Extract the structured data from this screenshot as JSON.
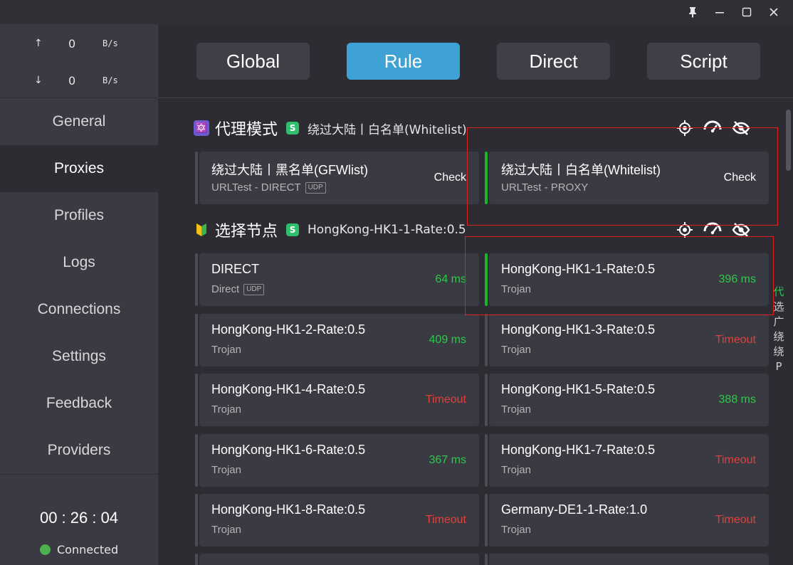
{
  "window": {
    "controls": [
      "pin-icon",
      "minimize-icon",
      "maximize-icon",
      "close-icon"
    ]
  },
  "speed": {
    "up_arrow": "↑",
    "up_value": "0",
    "up_unit": "B/s",
    "down_arrow": "↓",
    "down_value": "0",
    "down_unit": "B/s"
  },
  "nav": {
    "general": "General",
    "proxies": "Proxies",
    "profiles": "Profiles",
    "logs": "Logs",
    "connections": "Connections",
    "settings": "Settings",
    "feedback": "Feedback",
    "providers": "Providers"
  },
  "status": {
    "timer": "00 : 26 : 04",
    "connection": "Connected"
  },
  "modes": {
    "global": "Global",
    "rule": "Rule",
    "direct": "Direct",
    "script": "Script",
    "active": "Rule"
  },
  "groups": [
    {
      "emoji": "🔯",
      "title": "代理模式",
      "badge": "S",
      "current": "绕过大陆丨白名单(Whitelist)",
      "cards": [
        {
          "name": "绕过大陆丨黑名单(GFWlist)",
          "type": "URLTest - DIRECT",
          "udp": "UDP",
          "action": "Check",
          "selected": false
        },
        {
          "name": "绕过大陆丨白名单(Whitelist)",
          "type": "URLTest - PROXY",
          "udp": "",
          "action": "Check",
          "selected": true
        }
      ]
    },
    {
      "emoji": "🔰",
      "title": "选择节点",
      "badge": "S",
      "current": "HongKong-HK1-1-Rate:0.5",
      "cards": [
        {
          "name": "DIRECT",
          "type": "Direct",
          "udp": "UDP",
          "delay": "64 ms",
          "status": "ok",
          "selected": false
        },
        {
          "name": "HongKong-HK1-1-Rate:0.5",
          "type": "Trojan",
          "delay": "396 ms",
          "status": "ok",
          "selected": true
        },
        {
          "name": "HongKong-HK1-2-Rate:0.5",
          "type": "Trojan",
          "delay": "409 ms",
          "status": "ok",
          "selected": false
        },
        {
          "name": "HongKong-HK1-3-Rate:0.5",
          "type": "Trojan",
          "delay": "Timeout",
          "status": "bad",
          "selected": false
        },
        {
          "name": "HongKong-HK1-4-Rate:0.5",
          "type": "Trojan",
          "delay": "Timeout",
          "status": "bad",
          "selected": false
        },
        {
          "name": "HongKong-HK1-5-Rate:0.5",
          "type": "Trojan",
          "delay": "388 ms",
          "status": "ok",
          "selected": false
        },
        {
          "name": "HongKong-HK1-6-Rate:0.5",
          "type": "Trojan",
          "delay": "367 ms",
          "status": "ok",
          "selected": false
        },
        {
          "name": "HongKong-HK1-7-Rate:0.5",
          "type": "Trojan",
          "delay": "Timeout",
          "status": "bad",
          "selected": false
        },
        {
          "name": "HongKong-HK1-8-Rate:0.5",
          "type": "Trojan",
          "delay": "Timeout",
          "status": "bad",
          "selected": false
        },
        {
          "name": "Germany-DE1-1-Rate:1.0",
          "type": "Trojan",
          "delay": "Timeout",
          "status": "bad",
          "selected": false
        }
      ]
    }
  ],
  "side_list": [
    "代",
    "选",
    "广",
    "绕",
    "绕",
    "P"
  ],
  "colors": {
    "accent": "#3fa2d4",
    "selected_bar": "#18b52a",
    "ok": "#2ec84a",
    "bad": "#e0403c",
    "highlight_box": "#e02020"
  }
}
